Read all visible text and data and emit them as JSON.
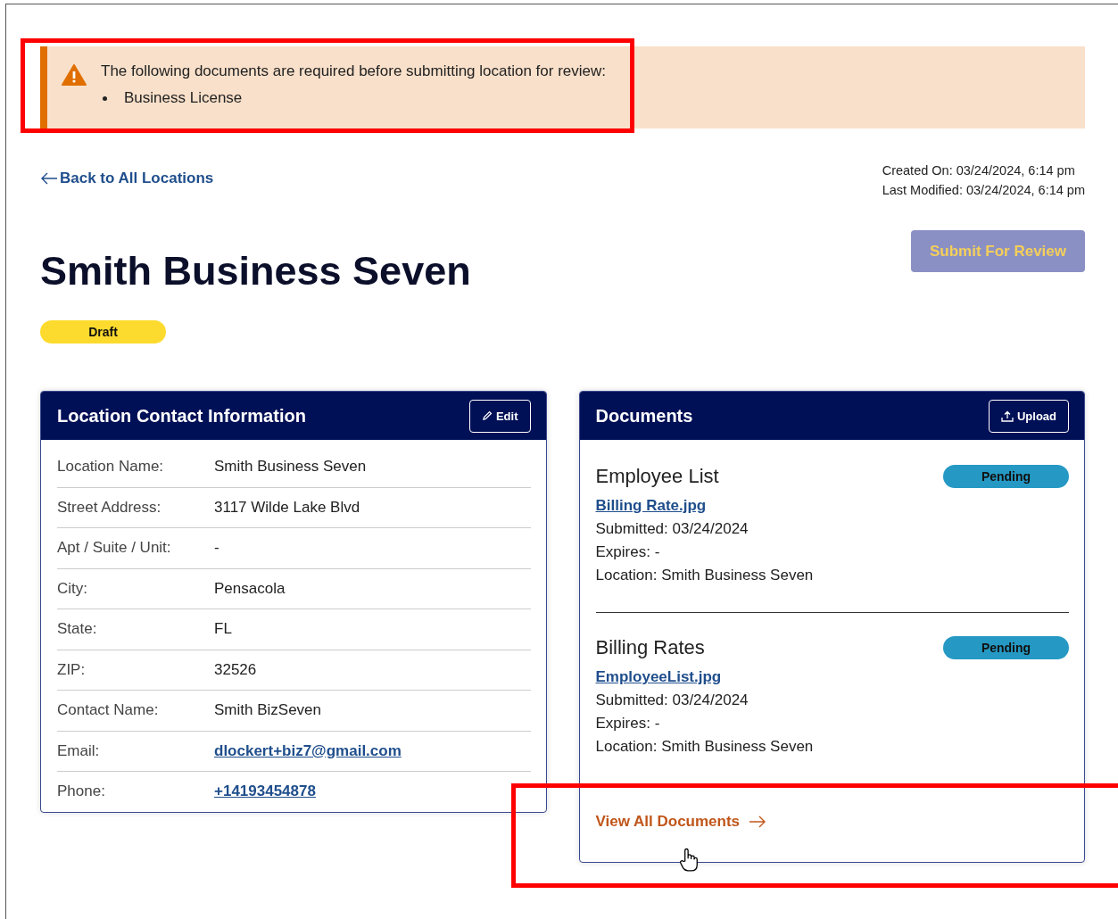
{
  "alert": {
    "message": "The following documents are required before submitting location for review:",
    "items": [
      "Business License"
    ]
  },
  "back_link": "Back to All Locations",
  "meta": [
    "Created On: 03/24/2024, 6:14 pm",
    "Last Modified: 03/24/2024, 6:14 pm"
  ],
  "title": "Smith Business Seven",
  "submit_button": {
    "label": "Submit For Review",
    "disabled": true
  },
  "status_badge": "Draft",
  "contact_card": {
    "title": "Location Contact Information",
    "button": "Edit",
    "rows": [
      {
        "label": "Location Name:",
        "value": "Smith Business Seven",
        "kind": "text"
      },
      {
        "label": "Street Address:",
        "value": "3117 Wilde Lake Blvd",
        "kind": "text"
      },
      {
        "label": "Apt / Suite / Unit:",
        "value": "-",
        "kind": "text"
      },
      {
        "label": "City:",
        "value": "Pensacola",
        "kind": "text"
      },
      {
        "label": "State:",
        "value": "FL",
        "kind": "text"
      },
      {
        "label": "ZIP:",
        "value": "32526",
        "kind": "text"
      },
      {
        "label": "Contact Name:",
        "value": "Smith BizSeven",
        "kind": "text"
      },
      {
        "label": "Email:",
        "value": "dlockert+biz7@gmail.com",
        "kind": "link"
      },
      {
        "label": "Phone:",
        "value": "+14193454878",
        "kind": "link"
      }
    ]
  },
  "documents_card": {
    "title": "Documents",
    "button": "Upload",
    "documents": [
      {
        "name": "Employee List",
        "status": "Pending",
        "file": "Billing Rate.jpg",
        "submitted": "Submitted: 03/24/2024",
        "expires": "Expires: -",
        "location": "Location: Smith Business Seven"
      },
      {
        "name": "Billing Rates",
        "status": "Pending",
        "file": "EmployeeList.jpg",
        "submitted": "Submitted: 03/24/2024",
        "expires": "Expires: -",
        "location": "Location: Smith Business Seven"
      }
    ],
    "footer_link": "View All Documents"
  }
}
